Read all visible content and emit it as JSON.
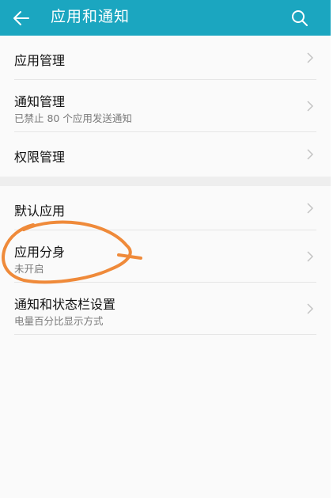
{
  "header": {
    "title": "应用和通知",
    "back_icon": "arrow-left-icon",
    "search_icon": "search-icon",
    "bg_color": "#1ba6c0"
  },
  "section1": [
    {
      "label": "应用管理",
      "sub": ""
    },
    {
      "label": "通知管理",
      "sub": "已禁止 80 个应用发送通知"
    },
    {
      "label": "权限管理",
      "sub": ""
    }
  ],
  "section2": [
    {
      "label": "默认应用",
      "sub": ""
    },
    {
      "label": "应用分身",
      "sub": "未开启"
    },
    {
      "label": "通知和状态栏设置",
      "sub": "电量百分比显示方式"
    }
  ],
  "annotation_color": "#ef8a3a"
}
